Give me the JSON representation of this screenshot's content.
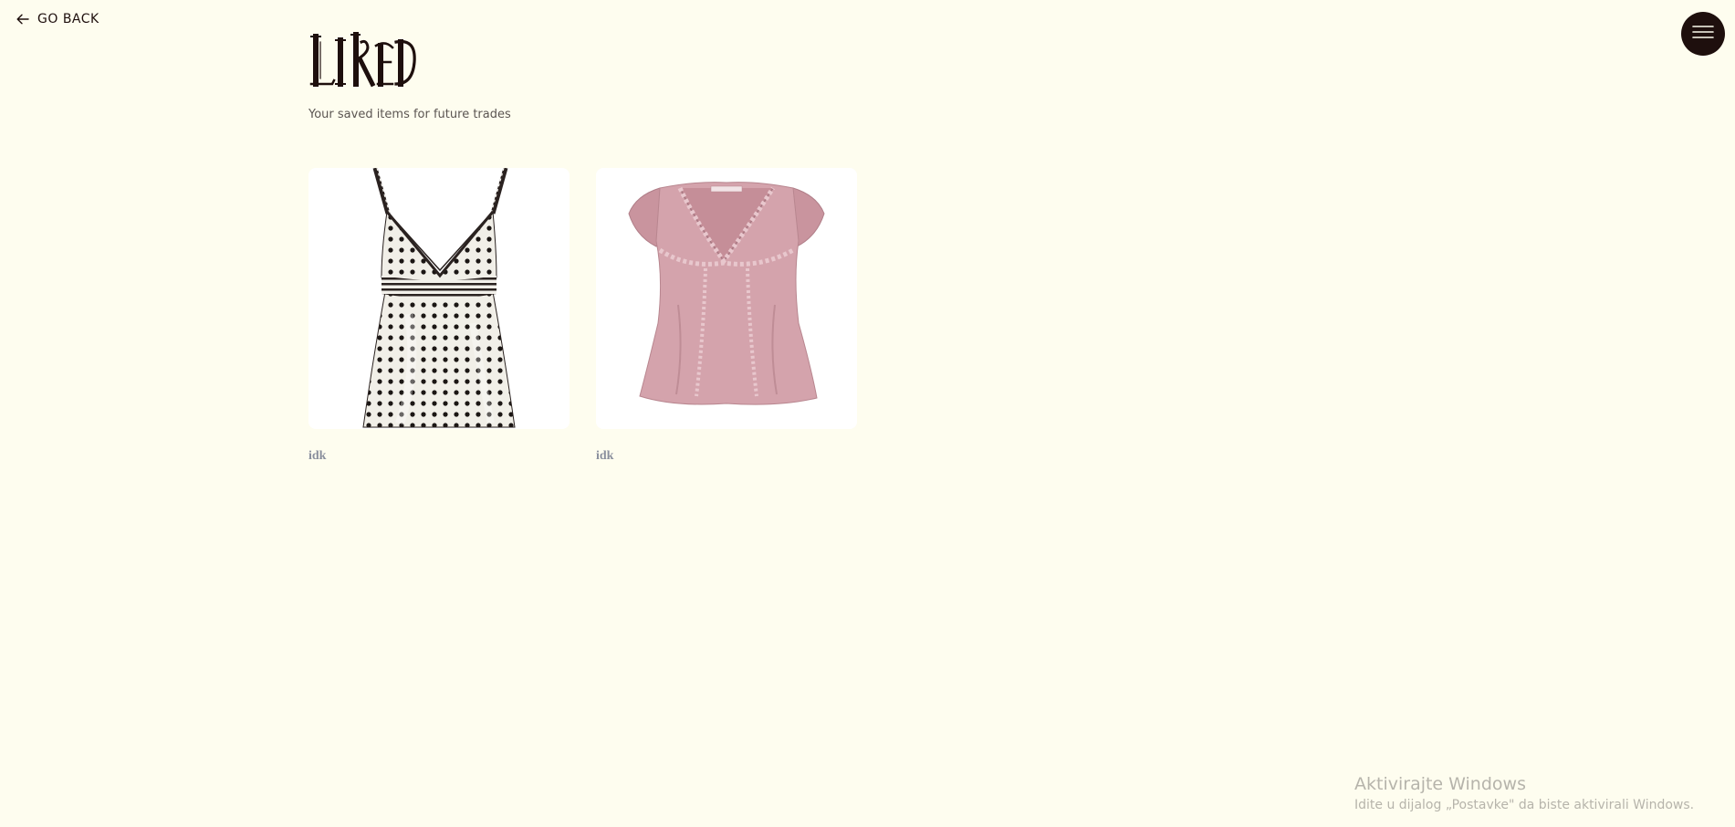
{
  "header": {
    "go_back_label": "GO BACK",
    "title": "LIKED",
    "subtitle": "Your saved items for future trades"
  },
  "menu": {
    "icon": "hamburger-icon",
    "color": "#1e0f0d"
  },
  "items": [
    {
      "name": "idk",
      "image": "polka-dot-camisole"
    },
    {
      "name": "idk",
      "image": "pink-lace-blouse"
    }
  ],
  "system_watermark": {
    "line1": "Aktivirajte Windows",
    "line2": "Idite u dijalog „Postavke\" da biste aktivirali Windows."
  },
  "colors": {
    "background": "#fefdef",
    "primary": "#1e0f0d",
    "muted_text": "#5b5552",
    "item_name": "#8a8f9d"
  }
}
